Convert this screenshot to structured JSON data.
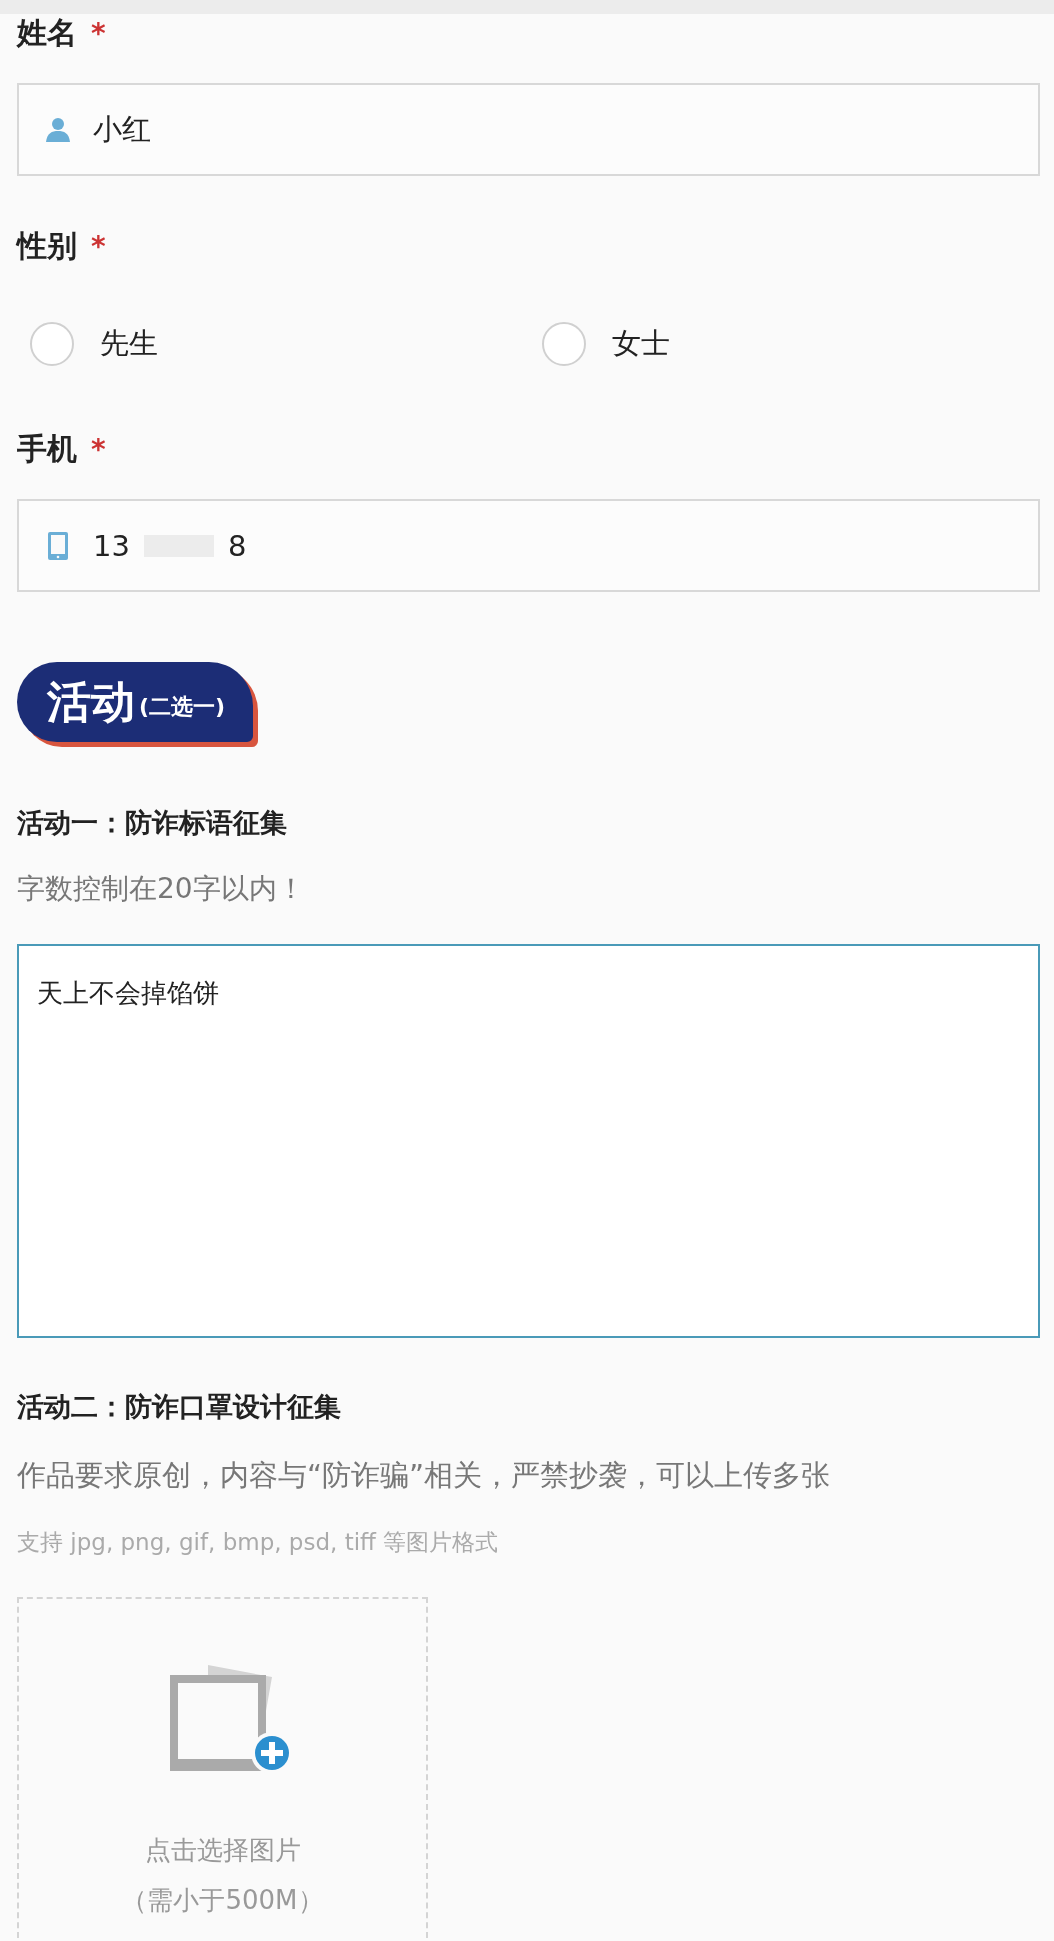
{
  "fields": [
    {
      "kind": "name",
      "label": "姓名",
      "required_mark": "*",
      "value": "小红"
    },
    {
      "kind": "radio",
      "label": "性别",
      "required_mark": "*",
      "options": [
        {
          "label": "先生",
          "selected": false
        },
        {
          "label": "女士",
          "selected": false
        }
      ]
    },
    {
      "kind": "phone",
      "label": "手机",
      "required_mark": "*",
      "value_start": "13",
      "redacted": true,
      "value_end": "8"
    }
  ],
  "section_banner": {
    "title": "活动",
    "subtitle": "(二选一)"
  },
  "activities": [
    {
      "kind": "slogan",
      "title": "活动一：防诈标语征集",
      "hint": "字数控制在20字以内！",
      "answer": "天上不会掉馅饼"
    },
    {
      "kind": "upload",
      "title": "活动二：防诈口罩设计征集",
      "description": "作品要求原创，内容与“防诈骗”相关，严禁抄袭，可以上传多张",
      "formats": "支持 jpg, png, gif, bmp, psd, tiff 等图片格式",
      "upload_label": "点击选择图片",
      "upload_note": "（需小于500M）"
    }
  ]
}
